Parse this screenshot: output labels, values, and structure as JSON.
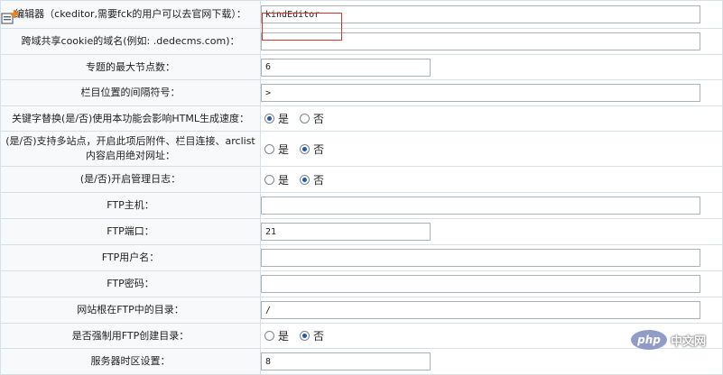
{
  "rows": [
    {
      "label": "编辑器（ckeditor,需要fck的用户可以去官网下载）：",
      "type": "text",
      "value": "kindEditor"
    },
    {
      "label": "跨域共享cookie的域名(例如: .dedecms.com)：",
      "type": "text",
      "value": ""
    },
    {
      "label": "专题的最大节点数：",
      "type": "text",
      "value": "6"
    },
    {
      "label": "栏目位置的间隔符号：",
      "type": "text",
      "value": ">"
    },
    {
      "label": "关键字替换(是/否)使用本功能会影响HTML生成速度：",
      "type": "radio",
      "selected": "是"
    },
    {
      "label": "(是/否)支持多站点，开启此项后附件、栏目连接、arclist内容启用绝对网址：",
      "type": "radio",
      "selected": "否"
    },
    {
      "label": "(是/否)开启管理日志：",
      "type": "radio",
      "selected": "否"
    },
    {
      "label": "FTP主机：",
      "type": "text",
      "value": ""
    },
    {
      "label": "FTP端口：",
      "type": "text",
      "value": "21"
    },
    {
      "label": "FTP用户名：",
      "type": "text",
      "value": ""
    },
    {
      "label": "FTP密码：",
      "type": "text",
      "value": ""
    },
    {
      "label": "网站根在FTP中的目录：",
      "type": "text",
      "value": "/"
    },
    {
      "label": "是否强制用FTP创建目录：",
      "type": "radio",
      "selected": "否"
    },
    {
      "label": "服务器时区设置：",
      "type": "text",
      "value": "8"
    }
  ],
  "radio_options": {
    "yes": "是",
    "no": "否"
  },
  "watermark": {
    "logo": "php",
    "text": "中文网"
  },
  "colors": {
    "highlight": "#d9342b",
    "add_icon": "#f0821e",
    "radio_checked": "#2457a8",
    "label_bg": "#f7f9fb",
    "border": "#d6e0ea"
  },
  "icons": {
    "add": "add-icon"
  }
}
